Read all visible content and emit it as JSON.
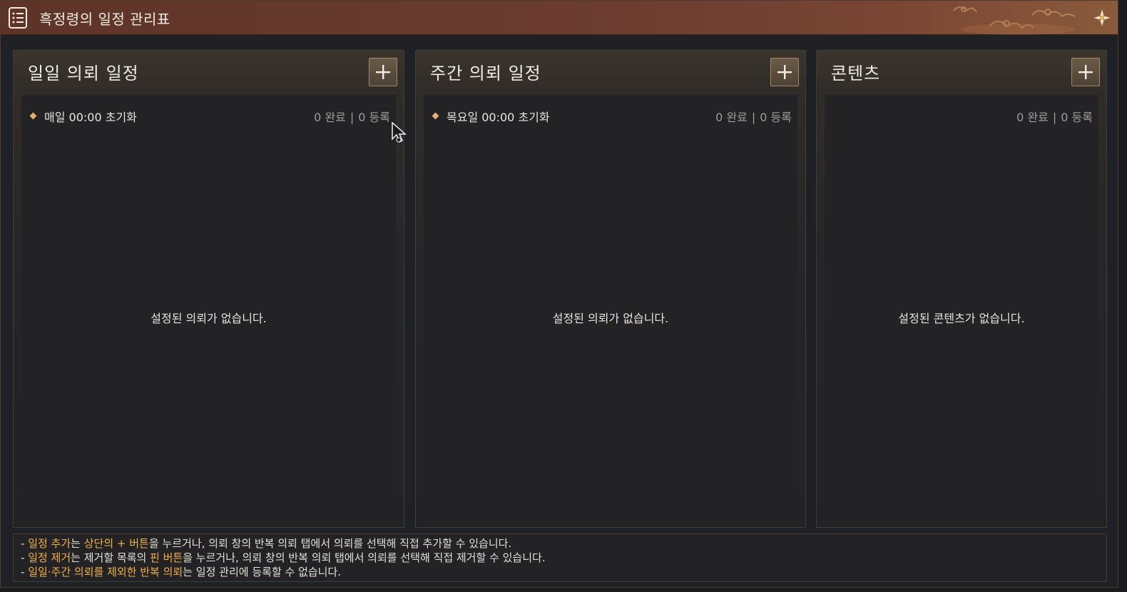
{
  "window": {
    "title": "흑정령의 일정 관리표",
    "icons": {
      "title": "list-document-icon",
      "emblem": "flower-emblem-icon",
      "decoration": "cloud-pattern-icon"
    }
  },
  "panels": [
    {
      "title": "일일 의뢰 일정",
      "add_icon": "plus-icon",
      "reset_label": "매일 00:00 초기화",
      "completed": "0 완료",
      "separator": "|",
      "registered": "0 등록",
      "empty_message": "설정된 의뢰가 없습니다."
    },
    {
      "title": "주간 의뢰 일정",
      "add_icon": "plus-icon",
      "reset_label": "목요일 00:00 초기화",
      "completed": "0 완료",
      "separator": "|",
      "registered": "0 등록",
      "empty_message": "설정된 의뢰가 없습니다."
    },
    {
      "title": "콘텐츠",
      "add_icon": "plus-icon",
      "completed": "0 완료",
      "separator": "|",
      "registered": "0 등록",
      "empty_message": "설정된 콘텐츠가 없습니다."
    }
  ],
  "help": {
    "lines": [
      [
        {
          "text": "- ",
          "highlight": false
        },
        {
          "text": "일정 추가",
          "highlight": true
        },
        {
          "text": "는 ",
          "highlight": false
        },
        {
          "text": "상단의 + 버튼",
          "highlight": true
        },
        {
          "text": "을 누르거나, 의뢰 창의 반복 의뢰 탭에서 의뢰를 선택해 직접 추가할 수 있습니다.",
          "highlight": false
        }
      ],
      [
        {
          "text": "- ",
          "highlight": false
        },
        {
          "text": "일정 제거",
          "highlight": true
        },
        {
          "text": "는 제거할 목록의 ",
          "highlight": false
        },
        {
          "text": "핀 버튼",
          "highlight": true
        },
        {
          "text": "을 누르거나, 의뢰 창의 반복 의뢰 탭에서 의뢰를 선택해 직접 제거할 수 있습니다.",
          "highlight": false
        }
      ],
      [
        {
          "text": "- ",
          "highlight": false
        },
        {
          "text": "일일·주간 의뢰를 제외한 반복 의뢰",
          "highlight": true
        },
        {
          "text": "는 일정 관리에 등록할 수 없습니다.",
          "highlight": false
        }
      ]
    ]
  },
  "colors": {
    "highlight": "#f0b045",
    "title_bar": "#6b3c2f",
    "accent_diamond": "#e8b067"
  },
  "mouse_cursor_icon": "mouse-pointer-icon"
}
